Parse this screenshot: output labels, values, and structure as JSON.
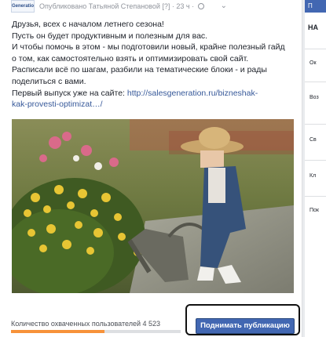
{
  "post": {
    "logo_text": "Generation",
    "meta_text": "Опубликовано Татьяной Степановой [?] · 23 ч ·",
    "text_lines": [
      "Друзья, всех с началом летнего сезона!",
      "Пусть он будет продуктивным и полезным для вас.",
      "И чтобы помочь в этом - мы подготовили новый, крайне полезный гайд",
      "о том, как самостоятельно взять и оптимизировать свой сайт.",
      "Расписали всё по шагам, разбили на тематические блоки - и рады",
      "поделиться с вами.",
      "Первый выпуск уже на сайте: "
    ],
    "link_line1": "http://salesgeneration.ru/bizneshak-",
    "link_line2": "kak-provesti-optimizat…/",
    "reach_text": "Количество охваченных пользователей 4 523",
    "reach_fraction": 0.55,
    "boost_label": "Поднимать публикацию"
  },
  "sidebar": {
    "top_label": "П",
    "title": "НА",
    "items": [
      "Ок",
      "Воз",
      "Св",
      "Кл",
      "Пок"
    ]
  },
  "colors": {
    "brand": "#4267b2",
    "link": "#365899",
    "reach": "#f7923a"
  }
}
